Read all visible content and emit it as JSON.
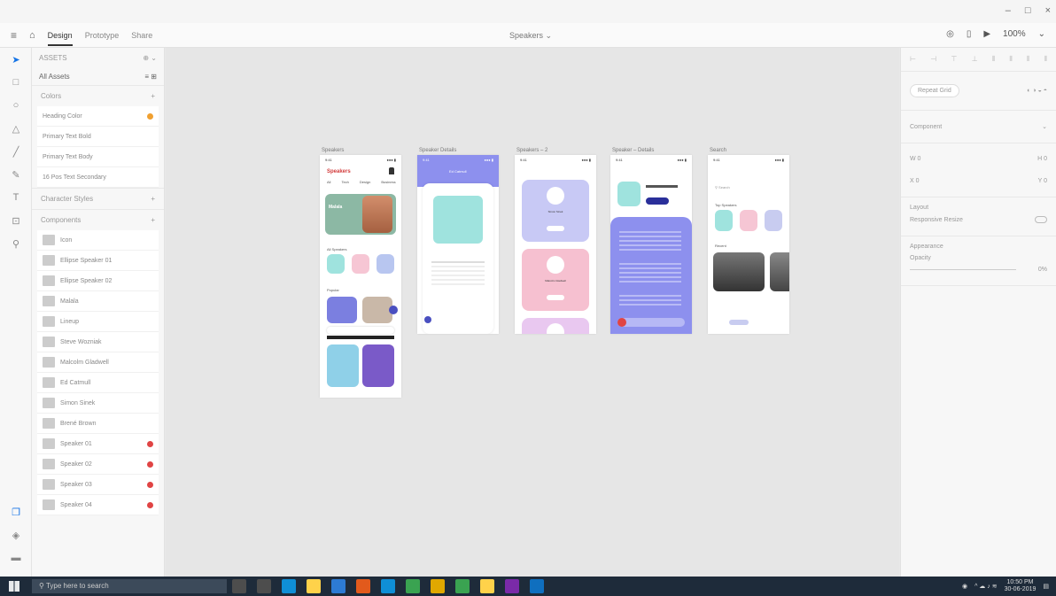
{
  "window": {
    "minimize": "–",
    "maximize": "□",
    "close": "×"
  },
  "toolbar": {
    "menu_icon": "hamburger-icon",
    "home_icon": "home-icon",
    "tabs": [
      {
        "label": "Design",
        "active": true
      },
      {
        "label": "Prototype",
        "active": false
      },
      {
        "label": "Share",
        "active": false
      }
    ],
    "doc_title": "Speakers",
    "zoom": "100%"
  },
  "tools": [
    "select",
    "rectangle",
    "ellipse",
    "polygon",
    "line",
    "pen",
    "text",
    "artboard",
    "zoom"
  ],
  "layers_panel": {
    "header": "ASSETS",
    "filter": "All Assets",
    "sections": {
      "colors": "Colors",
      "character_styles": "Character Styles",
      "components": "Components"
    },
    "color_items": [
      {
        "label": "Heading Color",
        "badge": "orange"
      },
      {
        "label": "Primary Text Bold"
      },
      {
        "label": "Primary Text Body"
      },
      {
        "label": "16 Pos Text Secondary"
      }
    ],
    "component_items": [
      {
        "label": "Icon",
        "dot": false
      },
      {
        "label": "Ellipse Speaker 01",
        "dot": false
      },
      {
        "label": "Ellipse Speaker 02",
        "dot": false
      },
      {
        "label": "Malala",
        "dot": false
      },
      {
        "label": "Lineup",
        "dot": false
      },
      {
        "label": "Steve Wozniak",
        "dot": false
      },
      {
        "label": "Malcolm Gladwell",
        "dot": false
      },
      {
        "label": "Ed Catmull",
        "dot": false
      },
      {
        "label": "Simon Sinek",
        "dot": false
      },
      {
        "label": "Brené Brown",
        "dot": false
      },
      {
        "label": "Speaker 01",
        "dot": true
      },
      {
        "label": "Speaker 02",
        "dot": true
      },
      {
        "label": "Speaker 03",
        "dot": true
      },
      {
        "label": "Speaker 04",
        "dot": true
      }
    ]
  },
  "artboards": [
    {
      "title": "Speakers"
    },
    {
      "title": "Speaker Details"
    },
    {
      "title": "Speakers – 2"
    },
    {
      "title": "Speaker – Details"
    },
    {
      "title": "Search"
    }
  ],
  "artboard_text": {
    "status_time": "9:41",
    "status_signal": "●●● ▮",
    "speakers_heading": "Speakers",
    "speakers_tabs": [
      "All",
      "Tech",
      "Design",
      "Business"
    ],
    "featured_name": "Malala",
    "section_all": "All Speakers",
    "section_more": "Popular",
    "details_title": "Ed Catmull",
    "card1_name": "Simon Sinek",
    "card2_name": "Malcolm Gladwell",
    "search_placeholder": "Search",
    "search_section1": "Top Speakers",
    "search_section2": "Recent"
  },
  "properties_panel": {
    "responsive_resize": "Responsive Resize",
    "repeat_grid": "Repeat Grid",
    "appearance": "Appearance",
    "layout": "Layout",
    "opacity_label": "Opacity",
    "opacity_value": "0%",
    "w_label": "W",
    "h_label": "H",
    "x_label": "X",
    "y_label": "Y",
    "component": "Component"
  },
  "taskbar": {
    "search_placeholder": "Type here to search",
    "time": "10:50 PM",
    "date": "30-06-2019",
    "app_colors": [
      "#4d4d4d",
      "#4d4d4d",
      "#0f8fd6",
      "#ffd24a",
      "#2d7bd4",
      "#e25a1c",
      "#0f8fd6",
      "#3aa351",
      "#e0a800",
      "#3aa351",
      "#ffd24a",
      "#7a2aa8",
      "#0f6fbf"
    ]
  },
  "accent_colors": {
    "selection_blue": "#1473e6",
    "purple": "#7b7fe0",
    "pink": "#f5b8c8",
    "error_red": "#e04444",
    "orange": "#f0a030"
  }
}
